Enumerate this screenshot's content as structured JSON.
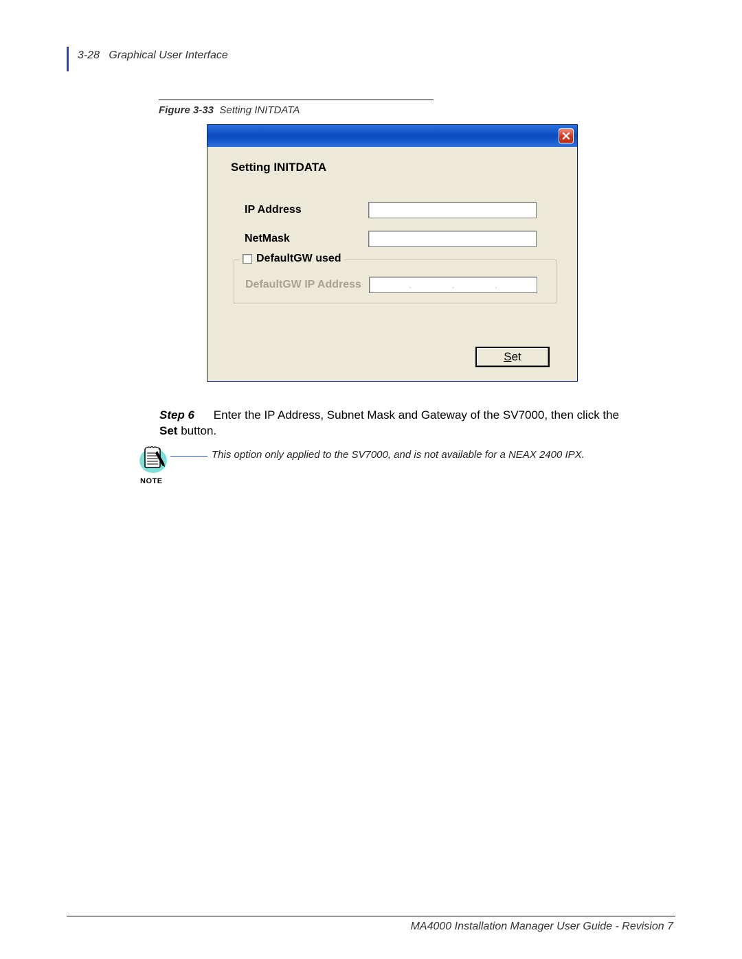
{
  "header": {
    "page_num": "3-28",
    "section_title": "Graphical User Interface"
  },
  "figure": {
    "label_prefix": "Figure 3-33",
    "label_title": "Setting INITDATA"
  },
  "dialog": {
    "title": "Setting INITDATA",
    "fields": {
      "ip_address_label": "IP Address",
      "ip_address_value": "",
      "netmask_label": "NetMask",
      "netmask_value": ""
    },
    "defaultgw": {
      "checkbox_label": "DefaultGW used",
      "ip_label": "DefaultGW IP Address"
    },
    "set_button_underline": "S",
    "set_button_rest": "et"
  },
  "step": {
    "label": "Step 6",
    "text_before_bold": "Enter the IP Address, Subnet Mask and Gateway of the SV7000, then click the ",
    "text_bold": "Set",
    "text_after_bold": " button."
  },
  "note": {
    "label": "NOTE",
    "text": "This option only applied to the SV7000, and is not available for a NEAX 2400 IPX."
  },
  "footer": {
    "text": "MA4000 Installation Manager User Guide - Revision 7"
  }
}
